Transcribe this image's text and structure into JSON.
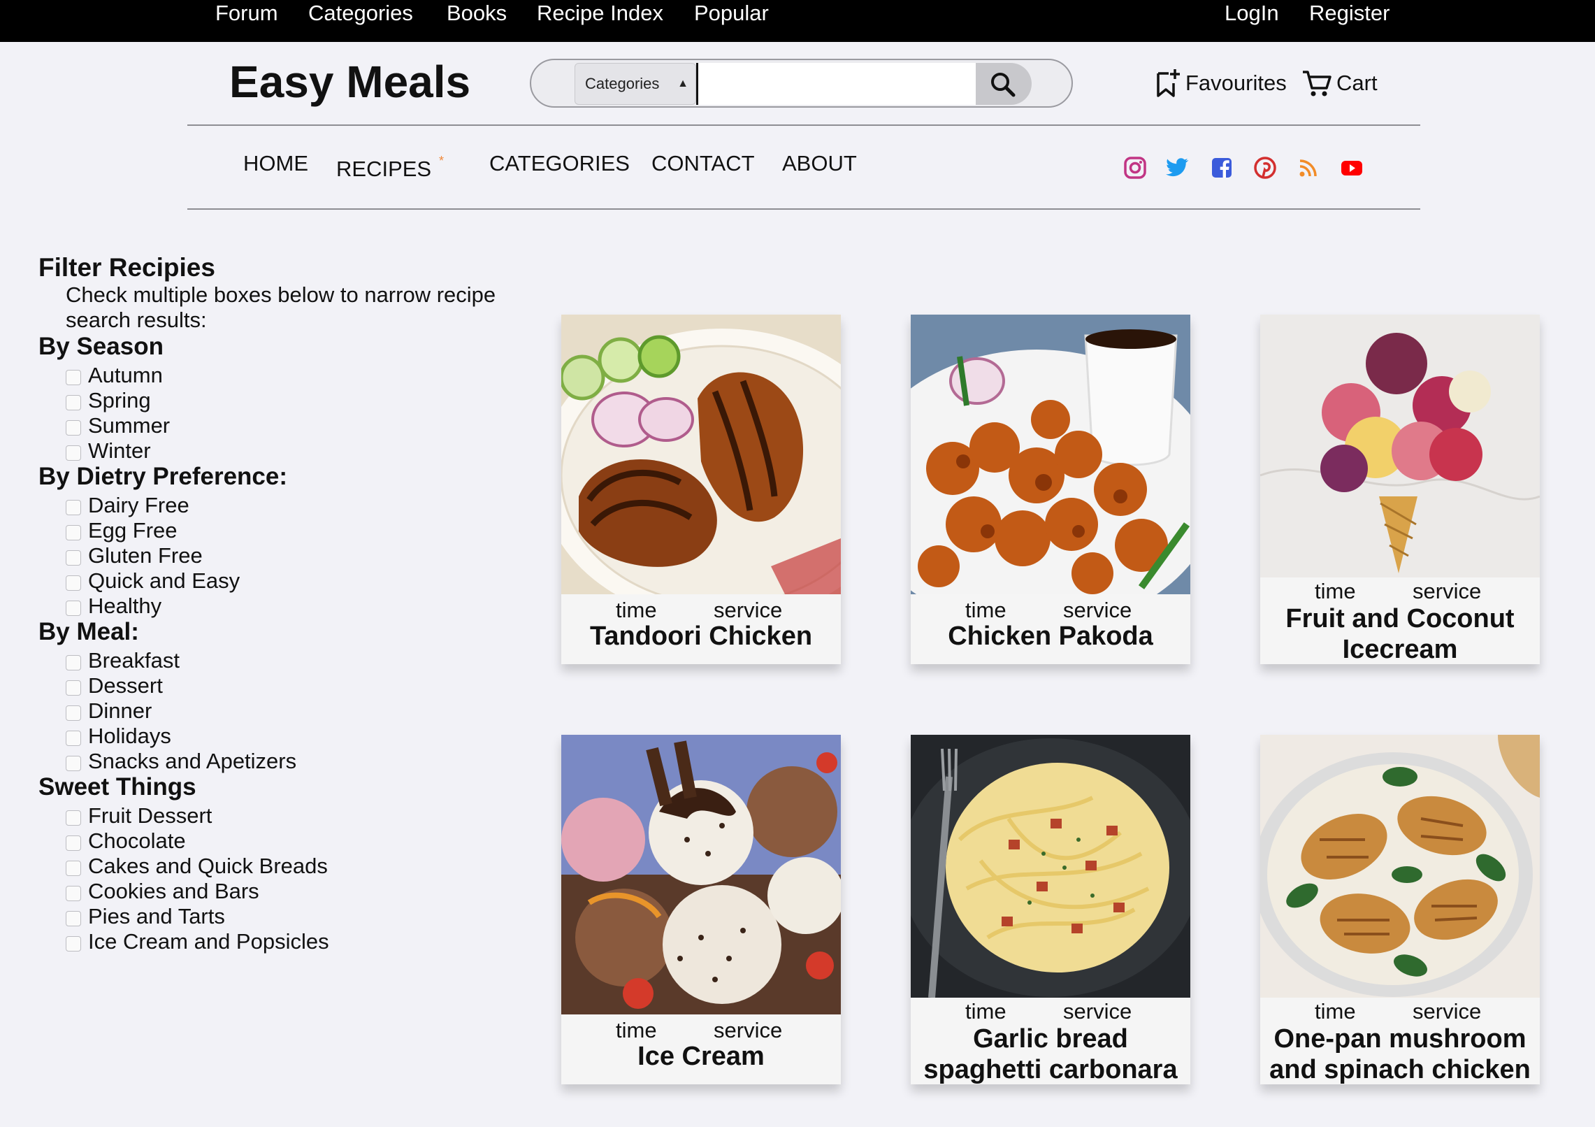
{
  "topbar": {
    "forum": "Forum",
    "categories": "Categories",
    "books": "Books",
    "recipe_index": "Recipe Index",
    "popular": "Popular",
    "login": "LogIn",
    "register": "Register"
  },
  "header": {
    "logo": "Easy Meals",
    "search": {
      "category_value": "Categories",
      "placeholder": ""
    },
    "favourites": "Favourites",
    "cart": "Cart"
  },
  "nav": {
    "home": "HOME",
    "recipes": "RECIPES",
    "recipes_marker": "*",
    "categories": "CATEGORIES",
    "contact": "CONTACT",
    "about": "ABOUT"
  },
  "social": {
    "icons": [
      "instagram-icon",
      "twitter-icon",
      "facebook-icon",
      "pinterest-icon",
      "rss-icon",
      "youtube-icon"
    ],
    "colors": {
      "instagram": "#c13584",
      "twitter": "#1d9bf0",
      "facebook": "#3b5bdb",
      "pinterest": "#d32f2f",
      "rss": "#f28c28",
      "youtube": "#ff0000"
    }
  },
  "filter": {
    "title": "Filter Recipies",
    "description": "Check multiple boxes below to narrow recipe search results:",
    "groups": [
      {
        "title": "By Season",
        "options": [
          "Autumn",
          "Spring",
          "Summer",
          "Winter"
        ]
      },
      {
        "title": "By Dietry Preference:",
        "options": [
          "Dairy Free",
          "Egg Free",
          "Gluten Free",
          "Quick and Easy",
          "Healthy"
        ]
      },
      {
        "title": "By Meal:",
        "options": [
          "Breakfast",
          "Dessert",
          "Dinner",
          "Holidays",
          "Snacks and Apetizers"
        ]
      },
      {
        "title": "Sweet Things",
        "options": [
          "Fruit Dessert",
          "Chocolate",
          "Cakes and Quick Breads",
          "Cookies and Bars",
          "Pies and Tarts",
          "Ice Cream and Popsicles"
        ]
      }
    ]
  },
  "recipes": [
    {
      "time_label": "time",
      "service_label": "service",
      "name": "Tandoori Chicken"
    },
    {
      "time_label": "time",
      "service_label": "service",
      "name": "Chicken Pakoda"
    },
    {
      "time_label": "time",
      "service_label": "service",
      "name": "Fruit and Coconut Icecream"
    },
    {
      "time_label": "time",
      "service_label": "service",
      "name": "Ice Cream"
    },
    {
      "time_label": "time",
      "service_label": "service",
      "name": "Garlic bread spaghetti carbonara"
    },
    {
      "time_label": "time",
      "service_label": "service",
      "name": "One-pan mushroom and spinach chicken"
    }
  ]
}
